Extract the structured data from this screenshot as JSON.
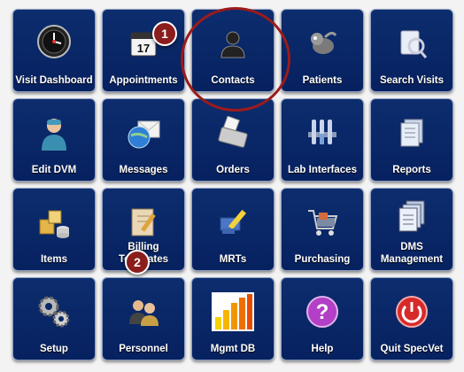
{
  "tiles": [
    {
      "label": "Visit Dashboard",
      "icon": "dashboard-clock-icon"
    },
    {
      "label": "Appointments",
      "icon": "calendar-icon"
    },
    {
      "label": "Contacts",
      "icon": "person-silhouette-icon"
    },
    {
      "label": "Patients",
      "icon": "pet-dog-icon"
    },
    {
      "label": "Search Visits",
      "icon": "clipboard-magnifier-icon"
    },
    {
      "label": "Edit DVM",
      "icon": "veterinarian-icon"
    },
    {
      "label": "Messages",
      "icon": "envelope-globe-icon"
    },
    {
      "label": "Orders",
      "icon": "register-printer-icon"
    },
    {
      "label": "Lab Interfaces",
      "icon": "test-tubes-icon"
    },
    {
      "label": "Reports",
      "icon": "documents-stack-icon"
    },
    {
      "label": "Items",
      "icon": "boxes-icon"
    },
    {
      "label": "Billing Templates",
      "icon": "notebook-pencil-icon"
    },
    {
      "label": "MRTs",
      "icon": "paintbrush-icon"
    },
    {
      "label": "Purchasing",
      "icon": "shopping-cart-icon"
    },
    {
      "label": "DMS Management",
      "icon": "document-pages-icon"
    },
    {
      "label": "Setup",
      "icon": "gears-icon"
    },
    {
      "label": "Personnel",
      "icon": "people-icon"
    },
    {
      "label": "Mgmt DB",
      "icon": "bar-chart-icon"
    },
    {
      "label": "Help",
      "icon": "question-mark-icon"
    },
    {
      "label": "Quit SpecVet",
      "icon": "power-icon"
    }
  ],
  "callouts": {
    "first": "1",
    "second": "2"
  },
  "colors": {
    "tile": "#0a2766",
    "callout": "#8b1d1d",
    "ring": "#9b1b1b"
  }
}
